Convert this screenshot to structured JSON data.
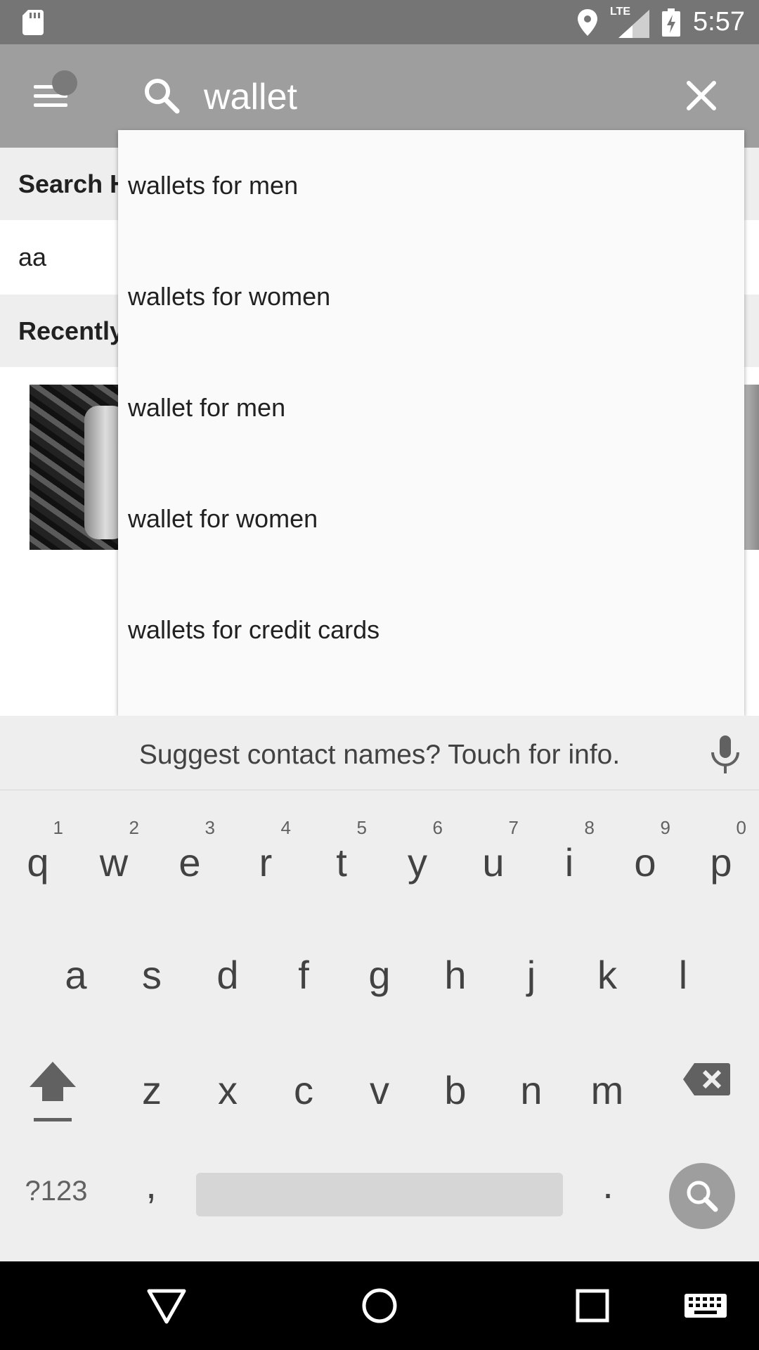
{
  "status_bar": {
    "time": "5:57",
    "network": "LTE",
    "icons": [
      "sd-card-icon",
      "location-icon",
      "signal-icon",
      "battery-charging-icon"
    ]
  },
  "app_bar": {
    "search_value": "wallet",
    "icons": [
      "menu-icon",
      "search-icon",
      "close-icon"
    ]
  },
  "background": {
    "search_history_header": "Search H",
    "history_items": [
      "aa"
    ],
    "recently_header": "Recently"
  },
  "suggestions": [
    "wallets for men",
    "wallets for women",
    "wallet for men",
    "wallet for women",
    "wallets for credit cards"
  ],
  "keyboard": {
    "suggestion_strip": "Suggest contact names? Touch for info.",
    "row1": [
      {
        "key": "q",
        "hint": "1"
      },
      {
        "key": "w",
        "hint": "2"
      },
      {
        "key": "e",
        "hint": "3"
      },
      {
        "key": "r",
        "hint": "4"
      },
      {
        "key": "t",
        "hint": "5"
      },
      {
        "key": "y",
        "hint": "6"
      },
      {
        "key": "u",
        "hint": "7"
      },
      {
        "key": "i",
        "hint": "8"
      },
      {
        "key": "o",
        "hint": "9"
      },
      {
        "key": "p",
        "hint": "0"
      }
    ],
    "row2": [
      "a",
      "s",
      "d",
      "f",
      "g",
      "h",
      "j",
      "k",
      "l"
    ],
    "row3": [
      "z",
      "x",
      "c",
      "v",
      "b",
      "n",
      "m"
    ],
    "symbols_label": "?123",
    "comma": ",",
    "period": "."
  },
  "colors": {
    "status_bar": "#757575",
    "app_bar": "#9e9e9e",
    "keyboard_bg": "#eeeeee",
    "nav_bar": "#000000"
  }
}
